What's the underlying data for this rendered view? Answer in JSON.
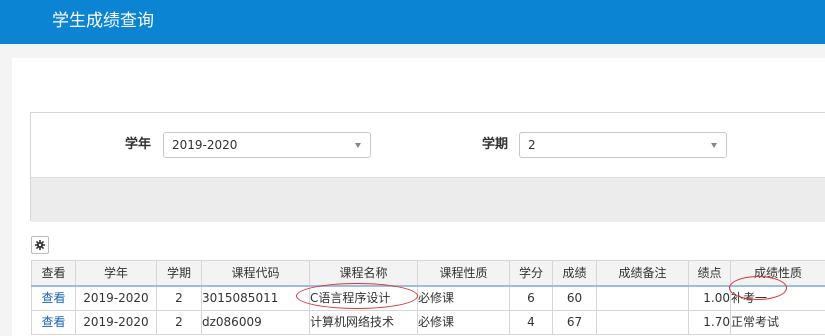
{
  "header": {
    "title": "学生成绩查询",
    "bg_color": "#0b84d4"
  },
  "filter": {
    "year_label": "学年",
    "year_value": "2019-2020",
    "term_label": "学期",
    "term_value": "2"
  },
  "toolbar": {
    "settings_icon": "gear-icon"
  },
  "table": {
    "headers": [
      "查看",
      "学年",
      "学期",
      "课程代码",
      "课程名称",
      "课程性质",
      "学分",
      "成绩",
      "成绩备注",
      "绩点",
      "成绩性质"
    ],
    "rows": [
      [
        "查看",
        "2019-2020",
        "2",
        "3015085011",
        "C语言程序设计",
        "必修课",
        "6",
        "60",
        "",
        "1.00",
        "补考一"
      ],
      [
        "查看",
        "2019-2020",
        "2",
        "dz086009",
        "计算机网络技术",
        "必修课",
        "4",
        "67",
        "",
        "1.70",
        "正常考试"
      ]
    ]
  },
  "annotation_color": "#d93636"
}
